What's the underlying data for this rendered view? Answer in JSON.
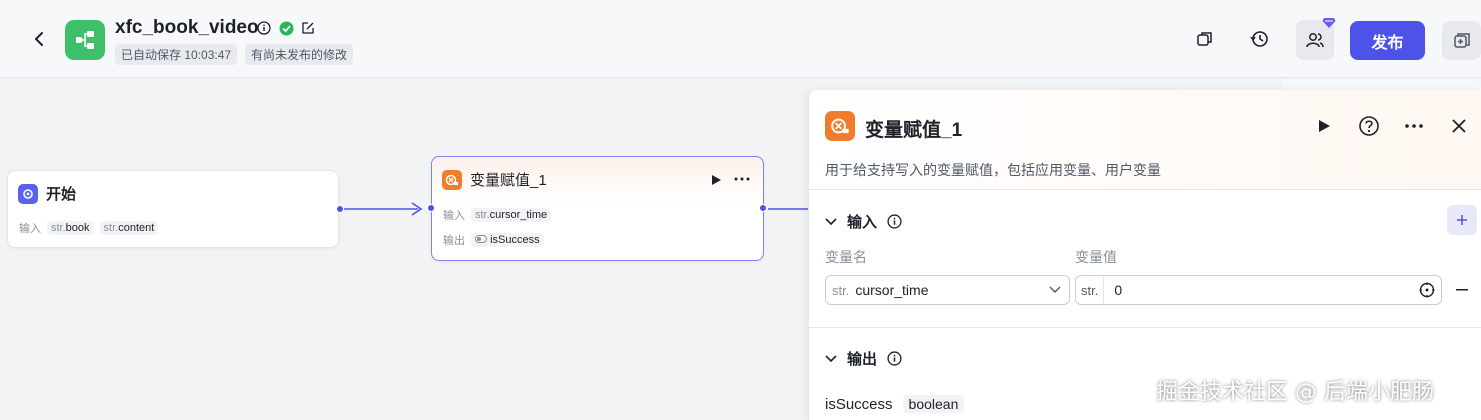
{
  "header": {
    "title": "xfc_book_video",
    "autosave": "已自动保存 10:03:47",
    "unpublished": "有尚未发布的修改",
    "publish_label": "发布"
  },
  "canvas": {
    "start_node": {
      "title": "开始",
      "input_label": "输入",
      "inputs": [
        {
          "type": "str.",
          "name": "book"
        },
        {
          "type": "str.",
          "name": "content"
        }
      ]
    },
    "var_node": {
      "title": "变量赋值_1",
      "input_label": "输入",
      "output_label": "输出",
      "input": {
        "type": "str.",
        "name": "cursor_time"
      },
      "output": {
        "name": "isSuccess"
      }
    }
  },
  "panel": {
    "title": "变量赋值_1",
    "description": "用于给支持写入的变量赋值，包括应用变量、用户变量",
    "input_section": "输入",
    "col_name": "变量名",
    "col_value": "变量值",
    "var_type": "str.",
    "var_name": "cursor_time",
    "value_type": "str.",
    "value": "0",
    "output_section": "输出",
    "output_name": "isSuccess",
    "output_type": "boolean"
  },
  "watermark": "掘金技术社区 @ 后端小肥肠",
  "colors": {
    "primary": "#4d53e8",
    "logo": "#3ec06b",
    "node_icon": "#f07c2c",
    "start_icon": "#5a60f0"
  }
}
